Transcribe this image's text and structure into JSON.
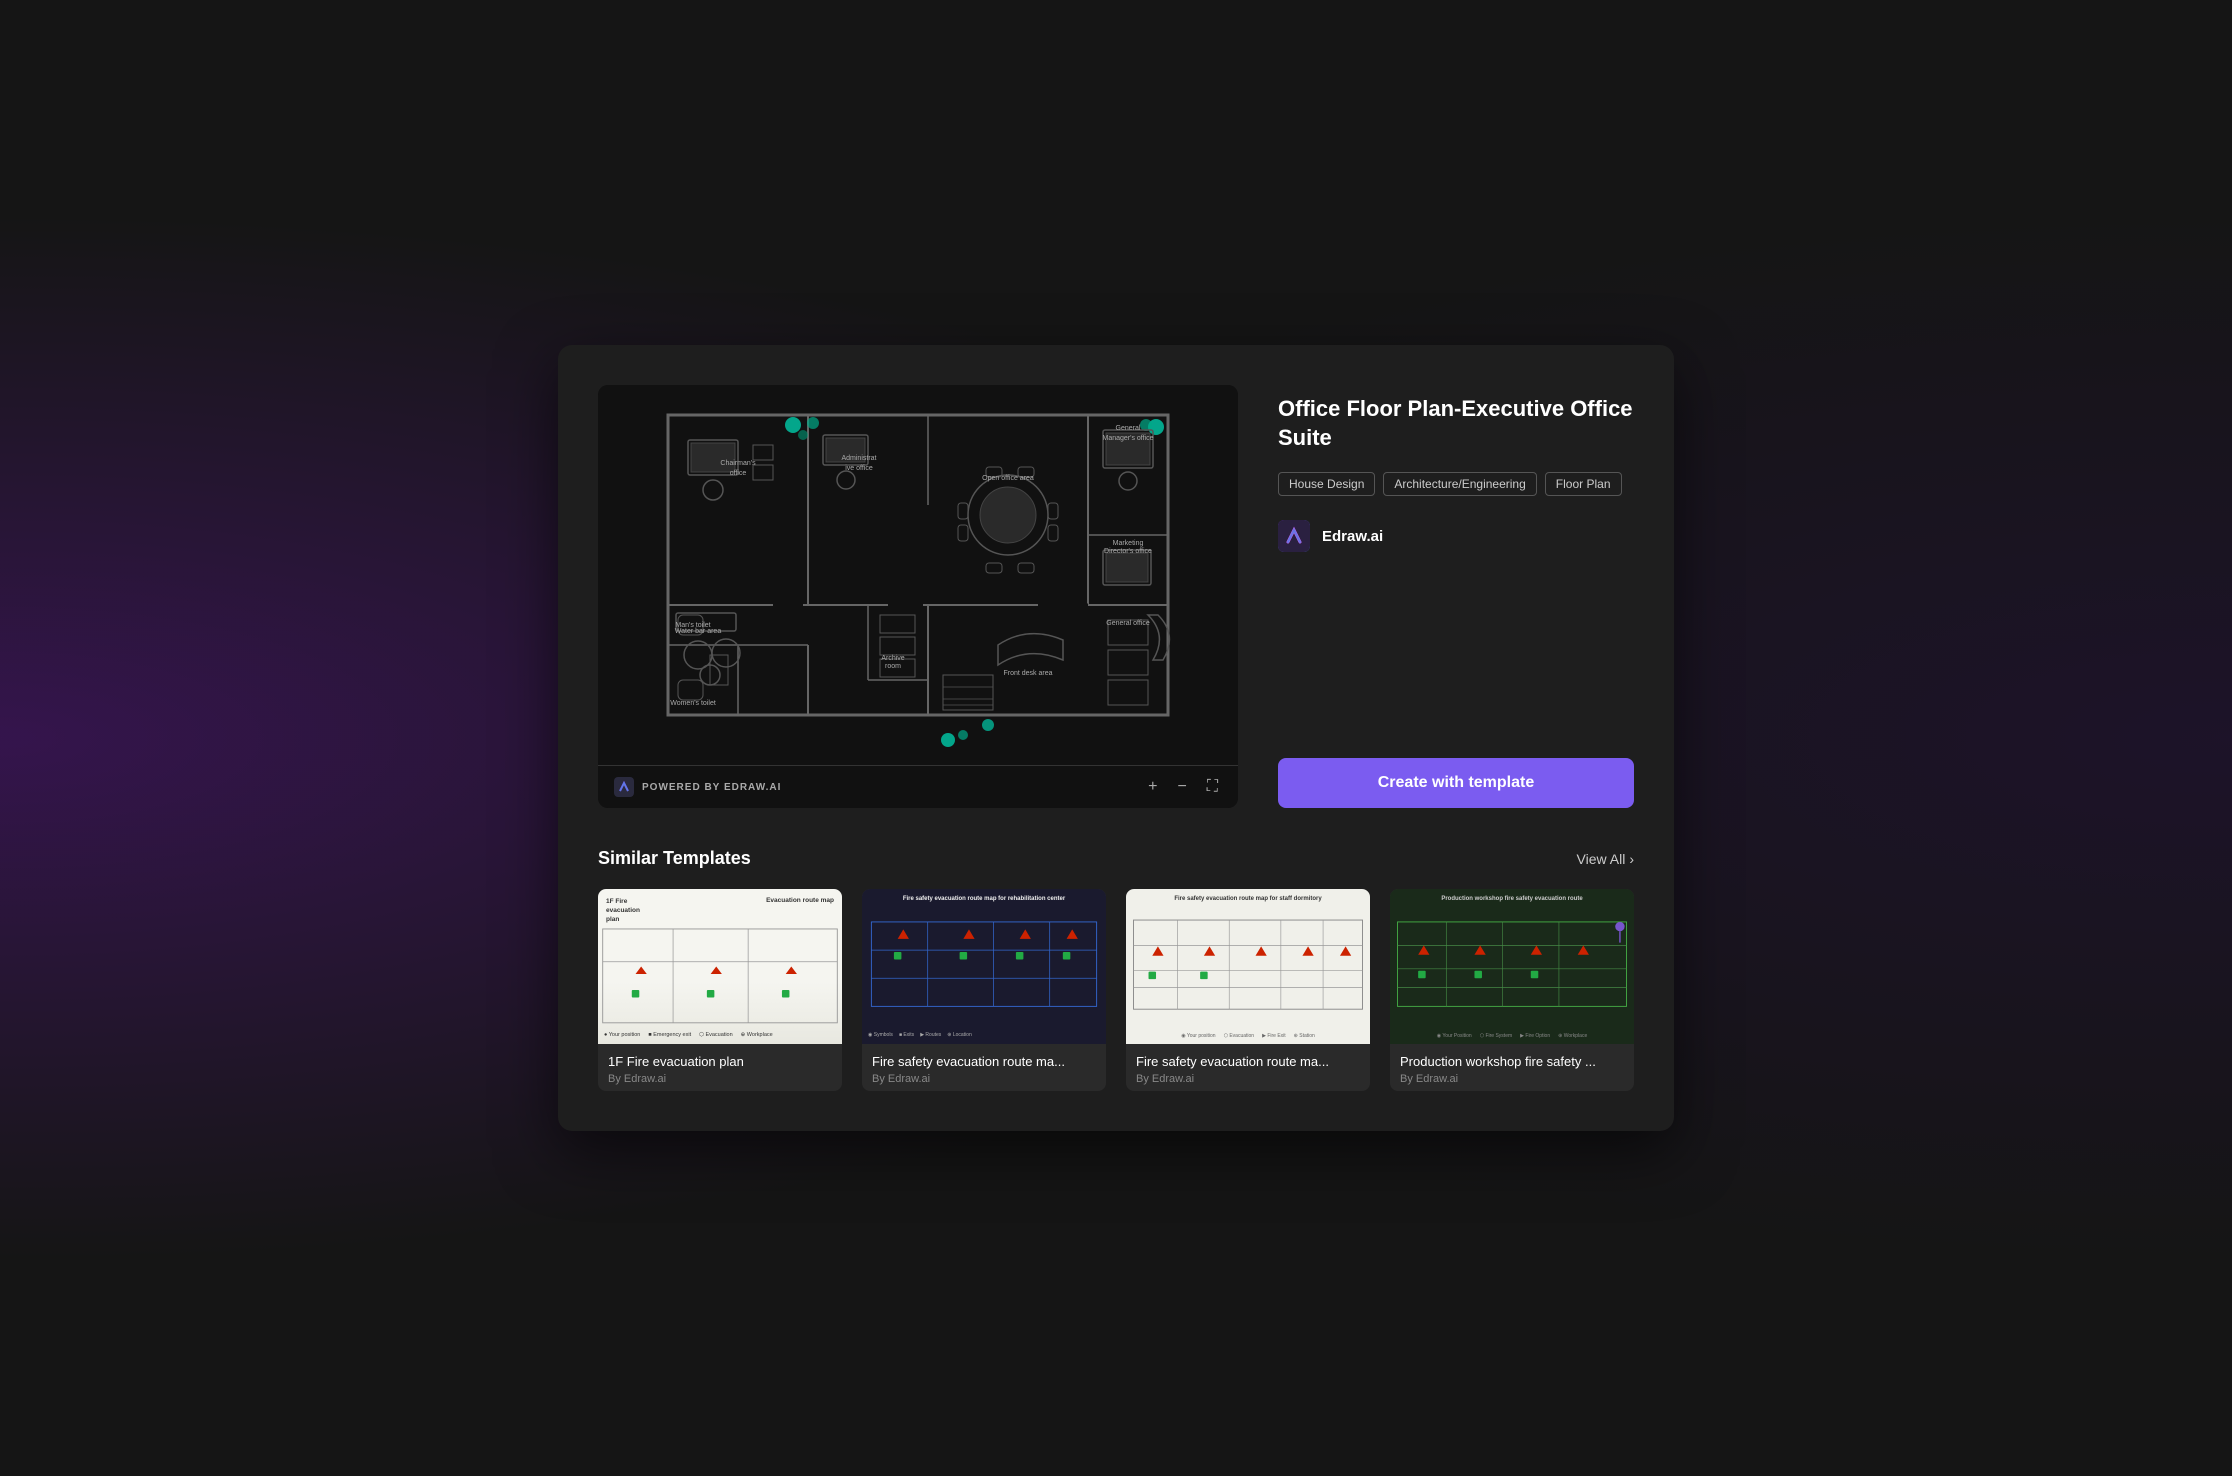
{
  "template": {
    "title": "Office Floor Plan-Executive Office Suite",
    "tags": [
      "House Design",
      "Architecture/Engineering",
      "Floor Plan"
    ],
    "author": {
      "name": "Edraw.ai",
      "logo_initials": "E"
    },
    "create_btn_label": "Create with template",
    "powered_by": "POWERED BY EDRAW.AI"
  },
  "preview": {
    "zoom_in_label": "+",
    "zoom_out_label": "−",
    "fullscreen_label": "⛶"
  },
  "similar": {
    "section_title": "Similar Templates",
    "view_all_label": "View All",
    "templates": [
      {
        "name": "1F Fire evacuation plan",
        "author": "By Edraw.ai",
        "thumb_style": "evac-thumb-1",
        "title_text": "1F Fire evacuation plan",
        "subtitle_text": "Evacuation route map"
      },
      {
        "name": "Fire safety evacuation route ma...",
        "author": "By Edraw.ai",
        "thumb_style": "evac-thumb-2",
        "title_text": "Fire safety evacuation route map for rehabilitation center",
        "subtitle_text": ""
      },
      {
        "name": "Fire safety evacuation route ma...",
        "author": "By Edraw.ai",
        "thumb_style": "evac-thumb-3",
        "title_text": "Fire safety evacuation route map for staff dormitory",
        "subtitle_text": ""
      },
      {
        "name": "Production workshop fire safety ...",
        "author": "By Edraw.ai",
        "thumb_style": "evac-thumb-4",
        "title_text": "Production workshop fire safety evacuation route",
        "subtitle_text": ""
      }
    ]
  }
}
